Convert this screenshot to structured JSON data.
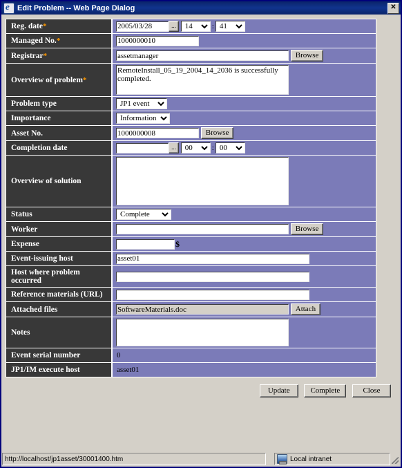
{
  "window": {
    "title": "Edit Problem -- Web Page Dialog",
    "icon": "ie-document-icon",
    "close_label": "Close window"
  },
  "form": {
    "required_marker": "*",
    "rows": [
      {
        "id": "reg-date",
        "label": "Reg. date",
        "required": true,
        "type": "datetime",
        "date_value": "2005/03/28",
        "hour_value": "14",
        "minute_value": "41",
        "separator": ":",
        "picker_label": "..."
      },
      {
        "id": "managed-no",
        "label": "Managed No.",
        "required": true,
        "type": "text",
        "value": "1000000010"
      },
      {
        "id": "registrar",
        "label": "Registrar",
        "required": true,
        "type": "text-browse",
        "value": "assetmanager",
        "button_label": "Browse"
      },
      {
        "id": "overview-of-problem",
        "label": "Overview of problem",
        "required": true,
        "type": "textarea",
        "value": "RemoteInstall_05_19_2004_14_2036 is successfully completed."
      },
      {
        "id": "problem-type",
        "label": "Problem type",
        "required": false,
        "type": "select",
        "value": "JP1 event"
      },
      {
        "id": "importance",
        "label": "Importance",
        "required": false,
        "type": "select",
        "value": "Information"
      },
      {
        "id": "asset-no",
        "label": "Asset No.",
        "required": false,
        "type": "text-browse",
        "value": "1000000008",
        "button_label": "Browse"
      },
      {
        "id": "completion-date",
        "label": "Completion date",
        "required": false,
        "type": "datetime",
        "date_value": "",
        "hour_value": "00",
        "minute_value": "00",
        "separator": ":",
        "picker_label": "..."
      },
      {
        "id": "overview-of-solution",
        "label": "Overview of solution",
        "required": false,
        "type": "textarea",
        "value": ""
      },
      {
        "id": "status",
        "label": "Status",
        "required": false,
        "type": "select",
        "value": "Complete"
      },
      {
        "id": "worker",
        "label": "Worker",
        "required": false,
        "type": "text-browse",
        "value": "",
        "button_label": "Browse"
      },
      {
        "id": "expense",
        "label": "Expense",
        "required": false,
        "type": "currency",
        "value": "",
        "suffix": "$"
      },
      {
        "id": "event-issuing-host",
        "label": "Event-issuing host",
        "required": false,
        "type": "text",
        "value": "asset01"
      },
      {
        "id": "host-where-problem-occurred",
        "label": "Host where problem occurred",
        "required": false,
        "type": "text",
        "value": ""
      },
      {
        "id": "reference-materials-url",
        "label": "Reference materials (URL)",
        "required": false,
        "type": "text",
        "value": ""
      },
      {
        "id": "attached-files",
        "label": "Attached files",
        "required": false,
        "type": "text-attach",
        "value": "SoftwareMaterials.doc",
        "button_label": "Attach"
      },
      {
        "id": "notes",
        "label": "Notes",
        "required": false,
        "type": "textarea",
        "value": ""
      },
      {
        "id": "event-serial-number",
        "label": "Event serial number",
        "required": false,
        "type": "static",
        "value": "0"
      },
      {
        "id": "jp1im-execute-host",
        "label": "JP1/IM execute host",
        "required": false,
        "type": "static",
        "value": "asset01"
      }
    ]
  },
  "buttons": {
    "update": "Update",
    "complete": "Complete",
    "close": "Close"
  },
  "statusbar": {
    "url": "http://localhost/jp1asset/30001400.htm",
    "zone": "Local intranet",
    "zone_icon": "intranet-globe-icon"
  },
  "colors": {
    "titlebar": "#0a246a",
    "label_bg": "#383838",
    "field_bg": "#7b7bb8",
    "dialog_bg": "#d4d0c8",
    "required_asterisk": "#ff9900"
  }
}
